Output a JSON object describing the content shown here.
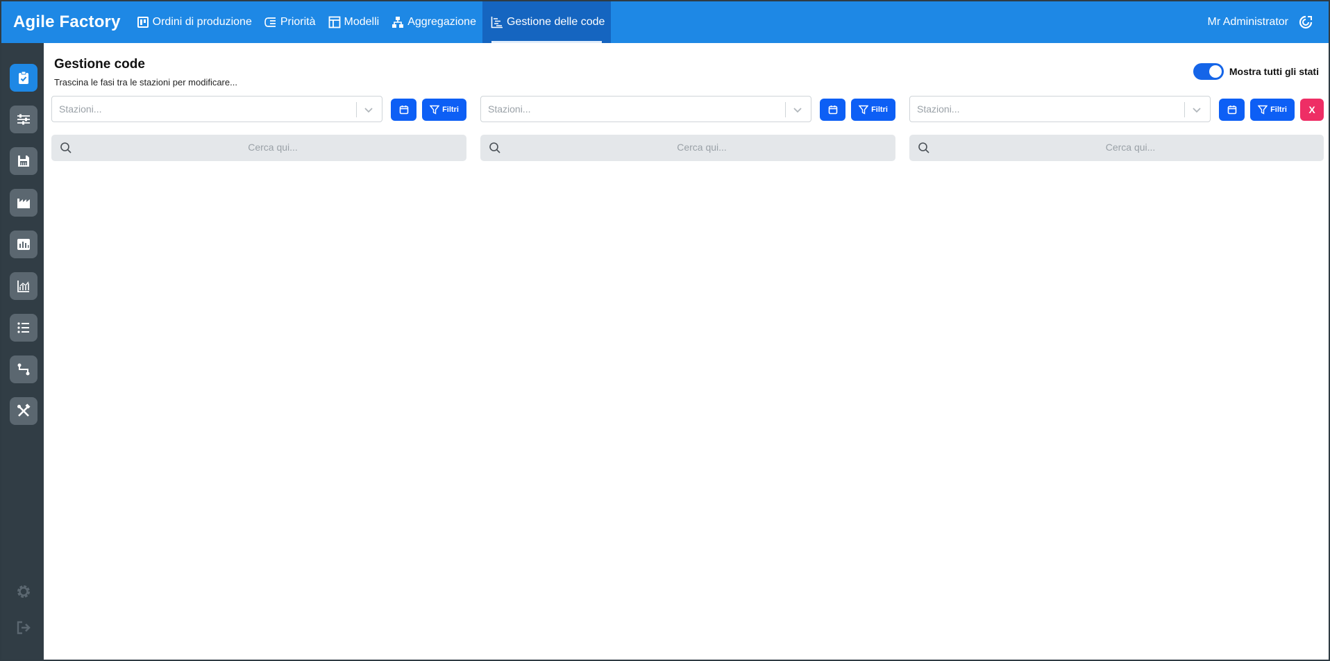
{
  "app": {
    "brand": "Agile Factory",
    "user": "Mr Administrator"
  },
  "nav": [
    {
      "label": "Ordini di produzione",
      "icon": "board-icon"
    },
    {
      "label": "Priorità",
      "icon": "priority-list-icon"
    },
    {
      "label": "Modelli",
      "icon": "template-icon"
    },
    {
      "label": "Aggregazione",
      "icon": "hierarchy-icon"
    },
    {
      "label": "Gestione delle code",
      "icon": "gantt-icon",
      "active": true
    }
  ],
  "sidebar": [
    "tasks-icon",
    "sliders-icon",
    "save-icon",
    "factory-icon",
    "bar-chart-icon",
    "line-chart-icon",
    "list-icon",
    "route-icon",
    "tools-icon",
    "settings-icon",
    "logout-icon"
  ],
  "page": {
    "title": "Gestione code",
    "subtitle": "Trascina le fasi tra le stazioni per modificare...",
    "toggle_label": "Mostra tutti gli stati",
    "toggle_on": true
  },
  "columns": [
    {
      "select_placeholder": "Stazioni...",
      "filter_label": "Filtri",
      "search_placeholder": "Cerca qui..."
    },
    {
      "select_placeholder": "Stazioni...",
      "filter_label": "Filtri",
      "search_placeholder": "Cerca qui..."
    },
    {
      "select_placeholder": "Stazioni...",
      "filter_label": "Filtri",
      "search_placeholder": "Cerca qui...",
      "close_label": "X"
    }
  ],
  "colors": {
    "primary": "#1e88e5",
    "active_nav": "#1565c0",
    "button": "#0d5ff5",
    "danger": "#ee2e65",
    "sidebar": "#313d45"
  }
}
